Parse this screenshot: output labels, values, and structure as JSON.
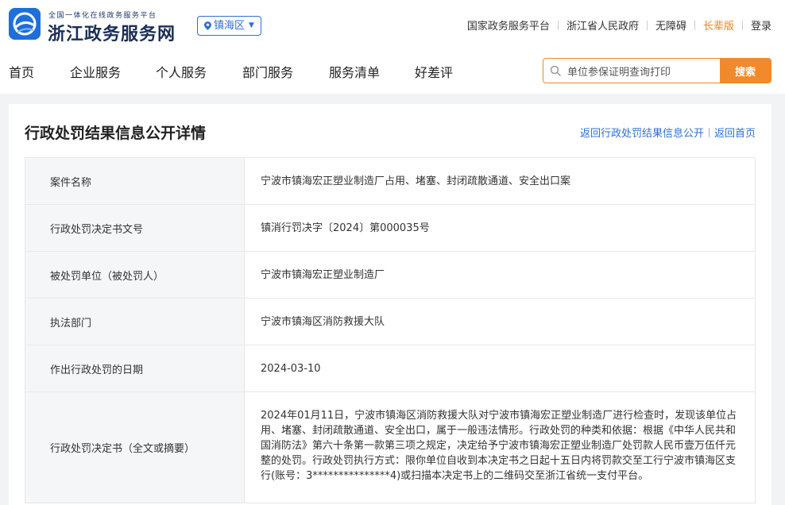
{
  "brand": {
    "tagline": "全国一体化在线政务服务平台",
    "name": "浙江政务服务网",
    "logo_icon": "zhejiang-gov-logo-icon"
  },
  "region": {
    "label": "镇海区",
    "icon": "location-pin-icon"
  },
  "top_links": [
    {
      "label": "国家政务服务平台"
    },
    {
      "label": "浙江省人民政府"
    },
    {
      "label": "无障碍"
    },
    {
      "label": "长辈版"
    },
    {
      "label": "登录"
    }
  ],
  "nav": {
    "items": [
      "首页",
      "企业服务",
      "个人服务",
      "部门服务",
      "服务清单",
      "好差评"
    ]
  },
  "search": {
    "value": "单位参保证明查询打印",
    "button": "搜索",
    "icon": "search-icon"
  },
  "colors": {
    "accent": "#f08a2c",
    "link": "#2e6fd8",
    "brand": "#1e6fd9"
  },
  "page": {
    "title": "行政处罚结果信息公开详情",
    "back_list": "返回行政处罚结果信息公开",
    "back_home": "返回首页"
  },
  "details": [
    {
      "label": "案件名称",
      "value": "宁波市镇海宏正塑业制造厂占用、堵塞、封闭疏散通道、安全出口案"
    },
    {
      "label": "行政处罚决定书文号",
      "value": "镇消行罚决字〔2024〕第000035号"
    },
    {
      "label": "被处罚单位（被处罚人）",
      "value": "宁波市镇海宏正塑业制造厂"
    },
    {
      "label": "执法部门",
      "value": "宁波市镇海区消防救援大队"
    },
    {
      "label": "作出行政处罚的日期",
      "value": "2024-03-10"
    },
    {
      "label": "行政处罚决定书（全文或摘要）",
      "value": "2024年01月11日，宁波市镇海区消防救援大队对宁波市镇海宏正塑业制造厂进行检查时，发现该单位占用、堵塞、封闭疏散通道、安全出口，属于一般违法情形。行政处罚的种类和依据：根据《中华人民共和国消防法》第六十条第一款第三项之规定，决定给予宁波市镇海宏正塑业制造厂处罚款人民币壹万伍仟元整的处罚。行政处罚执行方式：限你单位自收到本决定书之日起十五日内将罚款交至工行宁波市镇海区支行(账号：3***************4)或扫描本决定书上的二维码交至浙江省统一支付平台。"
    }
  ]
}
